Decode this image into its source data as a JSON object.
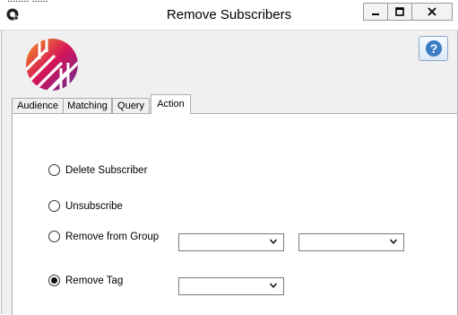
{
  "window": {
    "title": "Remove Subscribers",
    "clipped_text": "........ ......"
  },
  "tabs": [
    {
      "label": "Audience",
      "active": false
    },
    {
      "label": "Matching",
      "active": false
    },
    {
      "label": "Query",
      "active": false
    },
    {
      "label": "Action",
      "active": true
    }
  ],
  "action": {
    "options": [
      {
        "label": "Delete Subscriber",
        "checked": false
      },
      {
        "label": "Unsubscribe",
        "checked": false
      },
      {
        "label": "Remove from Group",
        "checked": false
      },
      {
        "label": "Remove Tag",
        "checked": true
      }
    ],
    "group_select_1": {
      "value": ""
    },
    "group_select_2": {
      "value": ""
    },
    "tag_select": {
      "value": ""
    }
  },
  "icons": {
    "app": "app-icon",
    "logo": "brand-logo-icon",
    "help": "help-icon",
    "minimize": "minimize-icon",
    "maximize": "maximize-icon",
    "close": "close-icon",
    "dropdown": "chevron-down-icon"
  },
  "colors": {
    "help_accent": "#3b7dc4",
    "logo_orange": "#f7941d",
    "logo_magenta": "#d4145a",
    "logo_purple": "#662d91"
  }
}
